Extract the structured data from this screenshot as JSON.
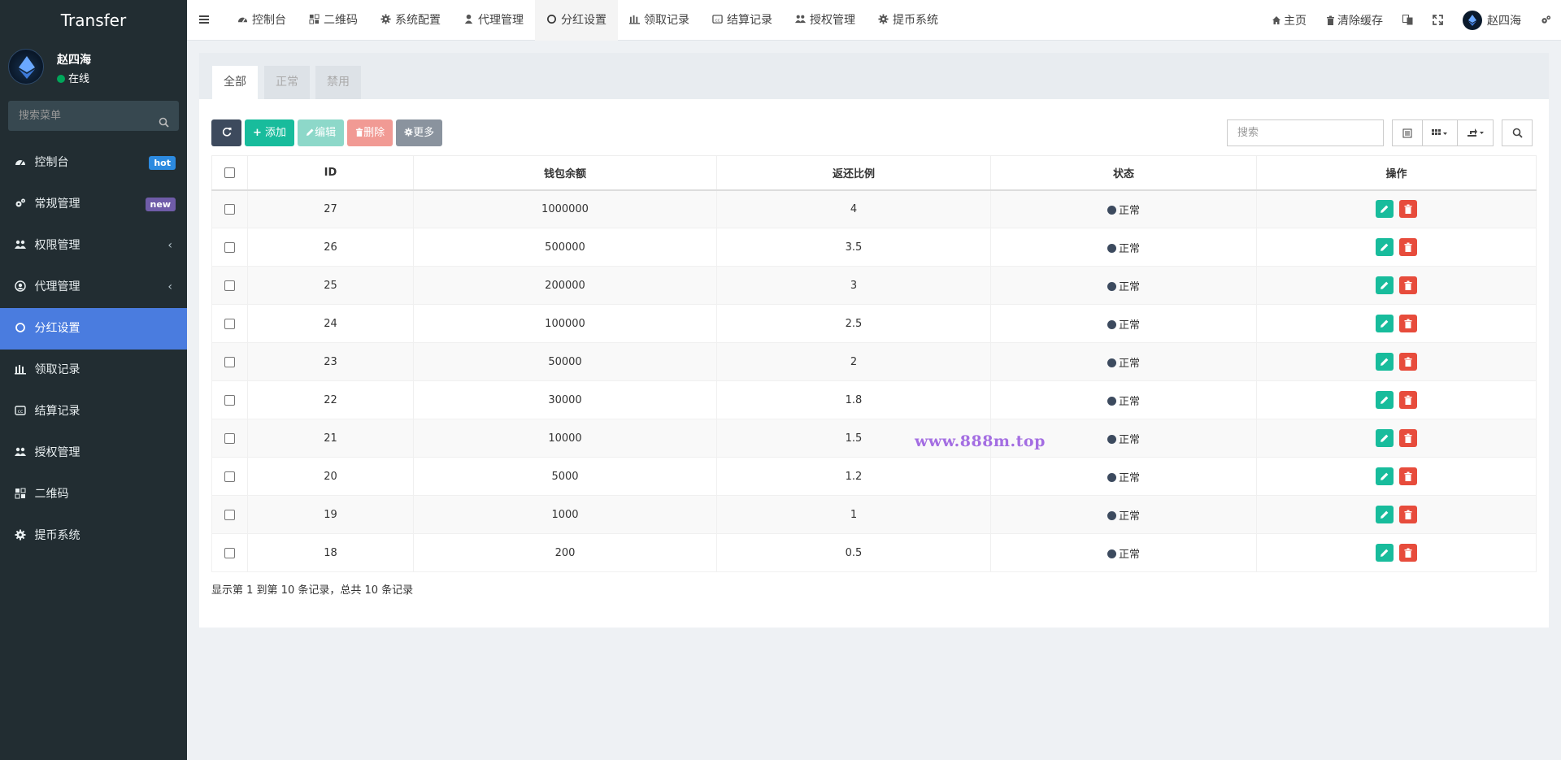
{
  "app": {
    "title": "Transfer"
  },
  "user": {
    "name": "赵四海",
    "status": "在线"
  },
  "sidebar": {
    "search_placeholder": "搜索菜单",
    "items": [
      {
        "label": "控制台",
        "icon": "dashboard-icon",
        "badge": "hot"
      },
      {
        "label": "常规管理",
        "icon": "cogs-icon",
        "badge": "new"
      },
      {
        "label": "权限管理",
        "icon": "group-icon",
        "chevron": true
      },
      {
        "label": "代理管理",
        "icon": "user-circle-icon",
        "chevron": true
      },
      {
        "label": "分红设置",
        "icon": "circle-icon",
        "active": true
      },
      {
        "label": "领取记录",
        "icon": "bar-icon"
      },
      {
        "label": "结算记录",
        "icon": "cc-icon"
      },
      {
        "label": "授权管理",
        "icon": "group-icon"
      },
      {
        "label": "二维码",
        "icon": "qrcode-icon"
      },
      {
        "label": "提币系统",
        "icon": "gear-icon"
      }
    ]
  },
  "topnav": {
    "tabs": [
      {
        "label": "控制台"
      },
      {
        "label": "二维码"
      },
      {
        "label": "系统配置"
      },
      {
        "label": "代理管理"
      },
      {
        "label": "分红设置",
        "active": true
      },
      {
        "label": "领取记录"
      },
      {
        "label": "结算记录"
      },
      {
        "label": "授权管理"
      },
      {
        "label": "提币系统"
      }
    ],
    "home_label": "主页",
    "clear_cache_label": "清除缓存",
    "user_name": "赵四海"
  },
  "filter_tabs": [
    "全部",
    "正常",
    "禁用"
  ],
  "toolbar": {
    "add_label": "添加",
    "edit_label": "编辑",
    "delete_label": "删除",
    "more_label": "更多",
    "search_placeholder": "搜索"
  },
  "table": {
    "headers": [
      "ID",
      "钱包余额",
      "返还比例",
      "状态",
      "操作"
    ],
    "rows": [
      {
        "id": "27",
        "balance": "1000000",
        "ratio": "4",
        "status": "正常"
      },
      {
        "id": "26",
        "balance": "500000",
        "ratio": "3.5",
        "status": "正常"
      },
      {
        "id": "25",
        "balance": "200000",
        "ratio": "3",
        "status": "正常"
      },
      {
        "id": "24",
        "balance": "100000",
        "ratio": "2.5",
        "status": "正常"
      },
      {
        "id": "23",
        "balance": "50000",
        "ratio": "2",
        "status": "正常"
      },
      {
        "id": "22",
        "balance": "30000",
        "ratio": "1.8",
        "status": "正常"
      },
      {
        "id": "21",
        "balance": "10000",
        "ratio": "1.5",
        "status": "正常"
      },
      {
        "id": "20",
        "balance": "5000",
        "ratio": "1.2",
        "status": "正常"
      },
      {
        "id": "19",
        "balance": "1000",
        "ratio": "1",
        "status": "正常"
      },
      {
        "id": "18",
        "balance": "200",
        "ratio": "0.5",
        "status": "正常"
      }
    ]
  },
  "pagination_info": "显示第 1 到第 10 条记录，总共 10 条记录",
  "watermark": "www.888m.top",
  "colors": {
    "sidebar_bg": "#222d32",
    "active_menu": "#4a7cdf",
    "success": "#18bc9c",
    "danger": "#e74c3c"
  }
}
